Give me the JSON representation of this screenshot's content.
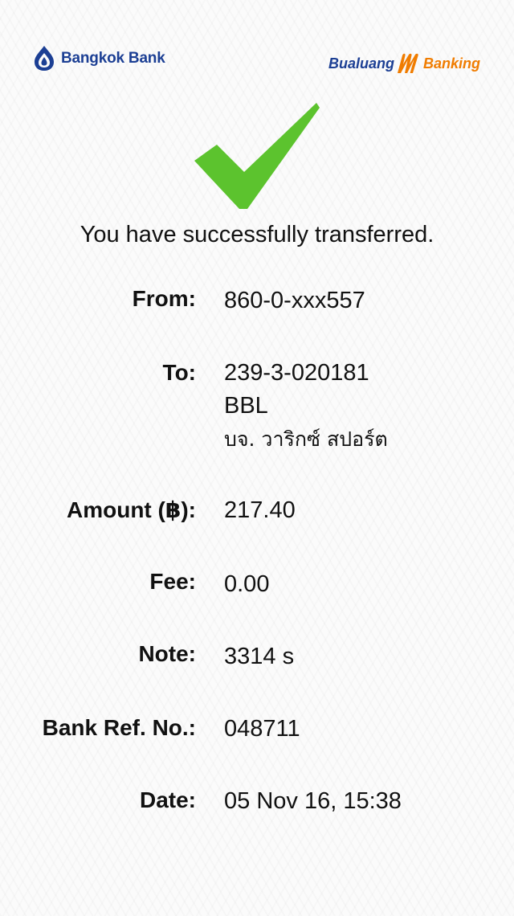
{
  "header": {
    "bank_name": "Bangkok Bank",
    "app_name_left": "Bualuang",
    "app_name_right": "Banking",
    "bank_logo_icon": "bangkok-bank-lotus-icon",
    "app_logo_icon": "m-banking-m-icon",
    "colors": {
      "brand_blue": "#1c3f94",
      "brand_orange": "#f07c00"
    }
  },
  "status": {
    "icon": "checkmark-icon",
    "icon_color": "#5cc32e",
    "message": "You have successfully transferred."
  },
  "transfer": {
    "from": {
      "label": "From:",
      "value": "860-0-xxx557"
    },
    "to": {
      "label": "To:",
      "account": "239-3-020181",
      "bank": "BBL",
      "name": "บจ. วาริกซ์ สปอร์ต"
    },
    "amount": {
      "label": "Amount (฿):",
      "value": "217.40"
    },
    "fee": {
      "label": "Fee:",
      "value": "0.00"
    },
    "note": {
      "label": "Note:",
      "value": "3314 s"
    },
    "ref": {
      "label": "Bank Ref. No.:",
      "value": "048711"
    },
    "date": {
      "label": "Date:",
      "value": "05 Nov 16, 15:38"
    }
  }
}
